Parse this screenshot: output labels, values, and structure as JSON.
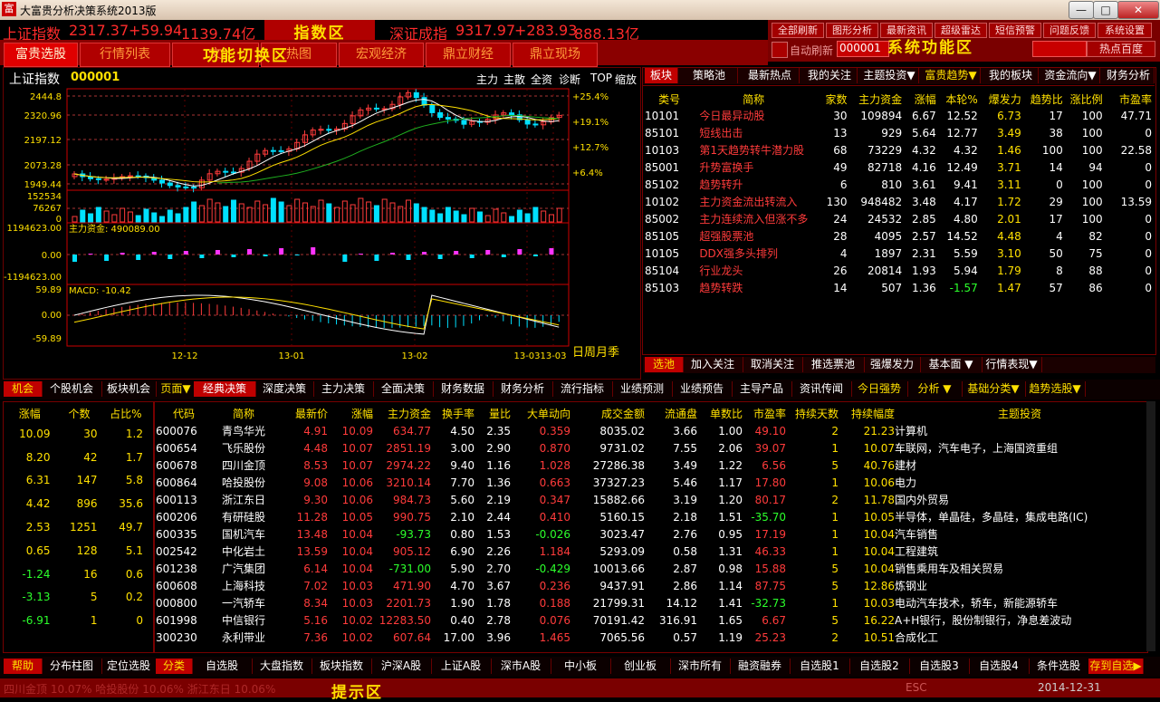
{
  "window": {
    "title": "大富贵分析决策系统2013版",
    "logo": "富",
    "btn_min": "—",
    "btn_max": "□",
    "btn_close": "✕"
  },
  "top": {
    "sh": {
      "name": "上证指数",
      "price": "2317.37",
      "change": "+59.94",
      "amount": "1139.74亿"
    },
    "sz": {
      "name": "深证成指",
      "price": "9317.97",
      "change": "+283.93",
      "amount": "888.13亿"
    },
    "zone_label": "指数区"
  },
  "func": {
    "row1": [
      "全部刷新",
      "图形分析",
      "最新资讯",
      "超级雷达",
      "短信预警",
      "问题反馈",
      "系统设置"
    ],
    "auto_refresh": "自动刷新",
    "code_value": "000001",
    "zone_label": "系统功能区",
    "search": "热点百度"
  },
  "nav": {
    "tabs": [
      "富贵选股",
      "行情列表",
      "文",
      "热图",
      "宏观经济",
      "鼎立财经",
      "鼎立现场"
    ],
    "zone_label": "功能切换区"
  },
  "chart": {
    "title": "上证指数",
    "code": "000001",
    "menu": [
      "主力",
      "主散",
      "全资",
      "诊断",
      "TOP",
      "缩放"
    ],
    "price_ticks": [
      "2444.8",
      "2320.96",
      "2197.12",
      "2073.28",
      "1949.44"
    ],
    "pct_ticks": [
      "+25.4%",
      "+19.1%",
      "+12.7%",
      "+6.4%"
    ],
    "vol_ticks": [
      "152534",
      "76267",
      "0"
    ],
    "fund_ticks": [
      "1194623.00",
      "0.00",
      "-1194623.00"
    ],
    "fund_label": "主力资金: 490089.00",
    "macd_ticks": [
      "59.89",
      "0.00",
      "-59.89"
    ],
    "macd_label": "MACD: -10.42",
    "dates": [
      "12-12",
      "13-01",
      "13-02",
      "13-03",
      "13-03"
    ],
    "period": "日周月季",
    "colors": {
      "up": "#ff3b3b",
      "down": "#00e0ff",
      "ma1": "#ffffff",
      "ma2": "#ffe000",
      "ma3": "#1faf1f"
    }
  },
  "sector": {
    "tabs": [
      "板块",
      "策略池",
      "最新热点",
      "我的关注",
      "主题投资▼",
      "富贵趋势▼",
      "我的板块",
      "资金流向▼",
      "财务分析"
    ],
    "headers": [
      "类号",
      "简称",
      "家数",
      "主力资金",
      "涨幅",
      "本轮%",
      "爆发力",
      "趋势比",
      "涨比例",
      "市盈率"
    ],
    "rows": [
      [
        "10101",
        "今日最异动股",
        "30",
        "109894",
        "6.67",
        "12.52",
        "6.73",
        "17",
        "100",
        "47.71"
      ],
      [
        "85101",
        "短线出击",
        "13",
        "929",
        "5.64",
        "12.77",
        "3.49",
        "38",
        "100",
        "0"
      ],
      [
        "10103",
        "第1天趋势转牛潜力股",
        "68",
        "73229",
        "4.32",
        "4.32",
        "1.46",
        "100",
        "100",
        "22.58"
      ],
      [
        "85001",
        "升势富换手",
        "49",
        "82718",
        "4.16",
        "12.49",
        "3.71",
        "14",
        "94",
        "0"
      ],
      [
        "85102",
        "趋势转升",
        "6",
        "810",
        "3.61",
        "9.41",
        "3.11",
        "0",
        "100",
        "0"
      ],
      [
        "10102",
        "主力资金流出转流入",
        "130",
        "948482",
        "3.48",
        "4.17",
        "1.72",
        "29",
        "100",
        "13.59"
      ],
      [
        "85002",
        "主力连续流入但涨不多",
        "24",
        "24532",
        "2.85",
        "4.80",
        "2.01",
        "17",
        "100",
        "0"
      ],
      [
        "85105",
        "超强股票池",
        "28",
        "4095",
        "2.57",
        "14.52",
        "4.48",
        "4",
        "82",
        "0"
      ],
      [
        "10105",
        "DDX强多头排列",
        "4",
        "1897",
        "2.31",
        "5.59",
        "3.10",
        "50",
        "75",
        "0"
      ],
      [
        "85104",
        "行业龙头",
        "26",
        "20814",
        "1.93",
        "5.94",
        "1.79",
        "8",
        "88",
        "0"
      ],
      [
        "85103",
        "趋势转跌",
        "14",
        "507",
        "1.36",
        "-1.57",
        "1.47",
        "57",
        "86",
        "0"
      ]
    ],
    "bottom_tabs": [
      "选池",
      "加入关注",
      "取消关注",
      "推选票池",
      "强爆发力",
      "基本面 ▼",
      "行情表现▼"
    ]
  },
  "dist": {
    "tabs": [
      "机会",
      "个股机会",
      "板块机会"
    ],
    "headers": [
      "涨幅",
      "个数",
      "占比%"
    ],
    "rows": [
      [
        "10.09",
        "30",
        "1.2"
      ],
      [
        "8.20",
        "42",
        "1.7"
      ],
      [
        "6.31",
        "147",
        "5.8"
      ],
      [
        "4.42",
        "896",
        "35.6"
      ],
      [
        "2.53",
        "1251",
        "49.7"
      ],
      [
        "0.65",
        "128",
        "5.1"
      ],
      [
        "-1.24",
        "16",
        "0.6"
      ],
      [
        "-3.13",
        "5",
        "0.2"
      ],
      [
        "-6.91",
        "1",
        "0"
      ]
    ]
  },
  "stock": {
    "tabs": [
      "页面▼",
      "经典决策",
      "深度决策",
      "主力决策",
      "全面决策",
      "财务数据",
      "财务分析",
      "流行指标",
      "业绩预测",
      "业绩预告",
      "主导产品",
      "资讯传闻",
      "今日强势",
      "分析 ▼",
      "基础分类▼",
      "趋势选股▼"
    ],
    "headers": [
      "代码",
      "简称",
      "最新价",
      "涨幅",
      "主力资金",
      "换手率",
      "量比",
      "大单动向",
      "成交金额",
      "流通盘",
      "单数比",
      "市盈率",
      "持续天数",
      "持续幅度",
      "主题投资"
    ],
    "rows": [
      [
        "600076",
        "青鸟华光",
        "4.91",
        "10.09",
        "634.77",
        "4.50",
        "2.35",
        "0.359",
        "8035.02",
        "3.66",
        "1.00",
        "49.10",
        "2",
        "21.23",
        "计算机"
      ],
      [
        "600654",
        "飞乐股份",
        "4.48",
        "10.07",
        "2851.19",
        "3.00",
        "2.90",
        "0.870",
        "9731.02",
        "7.55",
        "2.06",
        "39.07",
        "1",
        "10.07",
        "车联网，汽车电子，上海国资重组"
      ],
      [
        "600678",
        "四川金顶",
        "8.53",
        "10.07",
        "2974.22",
        "9.40",
        "1.16",
        "1.028",
        "27286.38",
        "3.49",
        "1.22",
        "6.56",
        "5",
        "40.76",
        "建材"
      ],
      [
        "600864",
        "哈投股份",
        "9.08",
        "10.06",
        "3210.14",
        "7.70",
        "1.36",
        "0.663",
        "37327.23",
        "5.46",
        "1.17",
        "17.80",
        "1",
        "10.06",
        "电力"
      ],
      [
        "600113",
        "浙江东日",
        "9.30",
        "10.06",
        "984.73",
        "5.60",
        "2.19",
        "0.347",
        "15882.66",
        "3.19",
        "1.20",
        "80.17",
        "2",
        "11.78",
        "国内外贸易"
      ],
      [
        "600206",
        "有研硅股",
        "11.28",
        "10.05",
        "990.75",
        "2.10",
        "2.44",
        "0.410",
        "5160.15",
        "2.18",
        "1.51",
        "-35.70",
        "1",
        "10.05",
        "半导体，单晶硅，多晶硅，集成电路(IC)"
      ],
      [
        "600335",
        "国机汽车",
        "13.48",
        "10.04",
        "-93.73",
        "0.80",
        "1.53",
        "-0.026",
        "3023.47",
        "2.76",
        "0.95",
        "17.19",
        "1",
        "10.04",
        "汽车销售"
      ],
      [
        "002542",
        "中化岩土",
        "13.59",
        "10.04",
        "905.12",
        "6.90",
        "2.26",
        "1.184",
        "5293.09",
        "0.58",
        "1.31",
        "46.33",
        "1",
        "10.04",
        "工程建筑"
      ],
      [
        "601238",
        "广汽集团",
        "6.14",
        "10.04",
        "-731.00",
        "5.90",
        "2.70",
        "-0.429",
        "10013.66",
        "2.87",
        "0.98",
        "15.88",
        "5",
        "10.04",
        "销售乘用车及相关贸易"
      ],
      [
        "600608",
        "上海科技",
        "7.02",
        "10.03",
        "471.90",
        "4.70",
        "3.67",
        "0.236",
        "9437.91",
        "2.86",
        "1.14",
        "87.75",
        "5",
        "12.86",
        "炼钢业"
      ],
      [
        "000800",
        "一汽轿车",
        "8.34",
        "10.03",
        "2201.73",
        "1.90",
        "1.78",
        "0.188",
        "21799.31",
        "14.12",
        "1.41",
        "-32.73",
        "1",
        "10.03",
        "电动汽车技术，轿车，新能源轿车"
      ],
      [
        "601998",
        "中信银行",
        "5.16",
        "10.02",
        "12283.50",
        "0.40",
        "2.78",
        "0.076",
        "70191.42",
        "316.91",
        "1.65",
        "6.67",
        "5",
        "16.22",
        "A+H银行，股份制银行，净息差波动"
      ],
      [
        "300230",
        "永利带业",
        "7.36",
        "10.02",
        "607.64",
        "17.00",
        "3.96",
        "1.465",
        "7065.56",
        "0.57",
        "1.19",
        "25.23",
        "2",
        "10.51",
        "合成化工"
      ]
    ]
  },
  "bottom": {
    "left_tabs": [
      "帮助",
      "分布柱图",
      "定位选股"
    ],
    "tabs": [
      "分类",
      "自选股",
      "大盘指数",
      "板块指数",
      "沪深A股",
      "上证A股",
      "深市A股",
      "中小板",
      "创业板",
      "深市所有",
      "融资融券",
      "自选股1",
      "自选股2",
      "自选股3",
      "自选股4",
      "条件选股",
      "存到自选▶"
    ]
  },
  "status": {
    "zone_label": "提示区",
    "ticker": "四川金顶 10.07% 哈投股份 10.06% 浙江东日 10.06%",
    "esc": "ESC",
    "date": "2014-12-31"
  }
}
